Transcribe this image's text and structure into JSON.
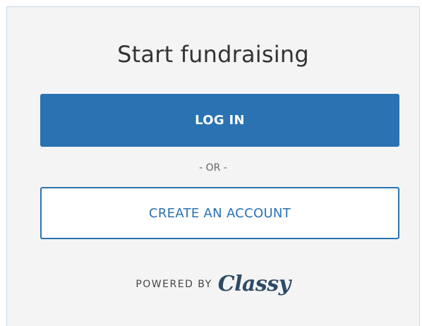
{
  "card": {
    "title": "Start fundraising",
    "login_label": "LOG IN",
    "separator": "- OR -",
    "create_label": "CREATE AN ACCOUNT"
  },
  "footer": {
    "powered_by": "POWERED BY",
    "brand": "Classy"
  },
  "colors": {
    "primary": "#2a72b2",
    "background": "#f4f4f4",
    "brand": "#2e4a66"
  }
}
